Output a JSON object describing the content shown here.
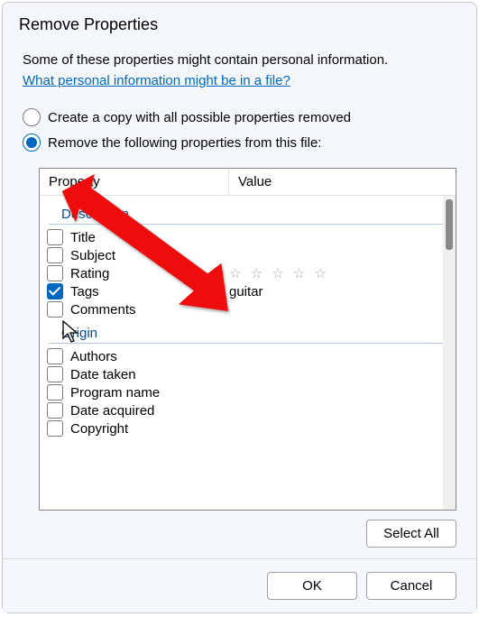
{
  "dialog": {
    "title": "Remove Properties",
    "intro": "Some of these properties might contain personal information.",
    "link": "What personal information might be in a file?"
  },
  "options": {
    "radio1": "Create a copy with all possible properties removed",
    "radio2": "Remove the following properties from this file:",
    "selected": "radio2"
  },
  "columns": {
    "property": "Property",
    "value": "Value"
  },
  "groups": {
    "description": "Description",
    "origin": "Origin"
  },
  "props": {
    "title": {
      "label": "Title",
      "value": ""
    },
    "subject": {
      "label": "Subject",
      "value": ""
    },
    "rating": {
      "label": "Rating",
      "value": ""
    },
    "tags": {
      "label": "Tags",
      "value": "guitar",
      "checked": true
    },
    "comments": {
      "label": "Comments",
      "value": ""
    },
    "authors": {
      "label": "Authors",
      "value": ""
    },
    "datetaken": {
      "label": "Date taken",
      "value": ""
    },
    "programname": {
      "label": "Program name",
      "value": ""
    },
    "dateacquired": {
      "label": "Date acquired",
      "value": ""
    },
    "copyright": {
      "label": "Copyright",
      "value": ""
    }
  },
  "rating_stars": "☆ ☆ ☆ ☆ ☆",
  "buttons": {
    "select_all": "Select All",
    "ok": "OK",
    "cancel": "Cancel"
  }
}
